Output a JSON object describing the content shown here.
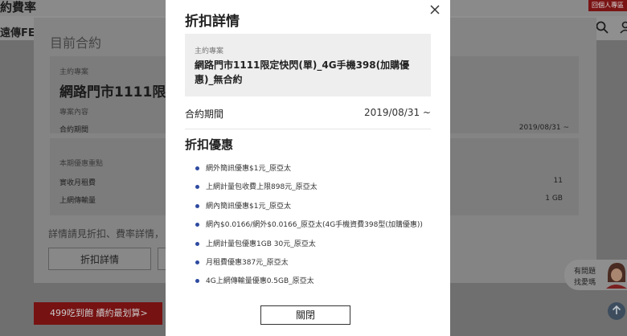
{
  "background": {
    "page_title": "約費率",
    "member_button": "回個人專區",
    "logo": "遠傳FE",
    "card_heading": "目前合約",
    "plan_label": "主約專案",
    "plan_name_truncated": "網路門市1111限定",
    "content_label": "專案內容",
    "period_label": "合約期間",
    "period_value": "2019/08/31 ~",
    "highlights_label": "本期優惠重點",
    "rent_label": "實收月租費",
    "rent_value": "11",
    "data_label": "上網傳輸量",
    "data_value": "1 GB",
    "note": "詳情請見折扣、費率詳情，",
    "discount_button": "折扣詳情",
    "promo_banner": "499吃到飽 續約最划算>",
    "chat_line1": "有問題",
    "chat_line2": "找愛瑪"
  },
  "modal": {
    "title": "折扣詳情",
    "plan_label": "主約專案",
    "plan_name": "網路門市1111限定快閃(單)_4G手機398(加購優惠)_無合約",
    "period_label": "合約期間",
    "period_value": "2019/08/31 ~",
    "discount_heading": "折扣優惠",
    "discounts": [
      "網外簡訊優惠$1元_原亞太",
      "上網計量包收費上限898元_原亞太",
      "網內簡訊優惠$1元_原亞太",
      "網內$0.0166/網外$0.0166_原亞太(4G手機資費398型(加購優惠))",
      "上網計量包優惠1GB 30元_原亞太",
      "月租費優惠387元_原亞太",
      "4G上網傳輸量優惠0.5GB_原亞太"
    ],
    "close_button": "關閉"
  },
  "colors": {
    "overlay": "#6f6f6f",
    "modal_bg": "#ffffff",
    "bullet": "#2e4aa0",
    "promo_red": "#771212"
  }
}
